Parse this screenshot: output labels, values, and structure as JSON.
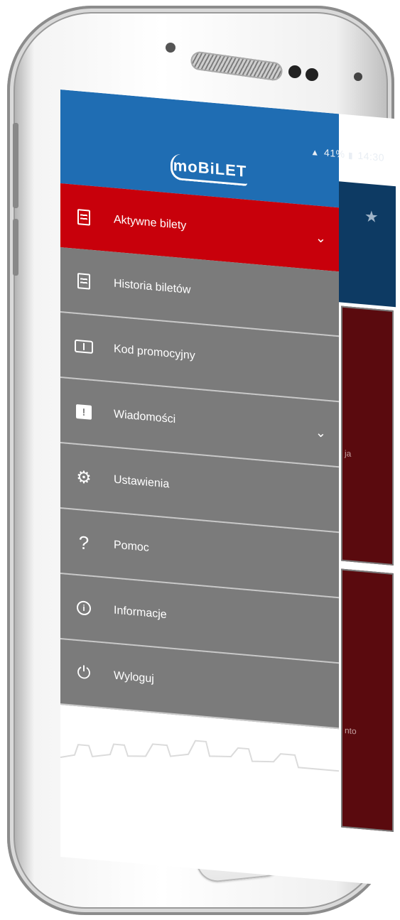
{
  "status_bar": {
    "battery": "41%",
    "time": "14:30"
  },
  "app": {
    "logo": "moBiLET"
  },
  "menu": {
    "items": [
      {
        "label": "Aktywne bilety",
        "icon": "ticket-icon",
        "active": true,
        "has_chevron": true
      },
      {
        "label": "Historia biletów",
        "icon": "ticket-icon",
        "active": false,
        "has_chevron": false
      },
      {
        "label": "Kod promocyjny",
        "icon": "card-icon",
        "active": false,
        "has_chevron": false
      },
      {
        "label": "Wiadomości",
        "icon": "message-icon",
        "active": false,
        "has_chevron": true
      },
      {
        "label": "Ustawienia",
        "icon": "gear-icon",
        "active": false,
        "has_chevron": false
      },
      {
        "label": "Pomoc",
        "icon": "question-icon",
        "active": false,
        "has_chevron": false
      },
      {
        "label": "Informacje",
        "icon": "info-icon",
        "active": false,
        "has_chevron": false
      },
      {
        "label": "Wyloguj",
        "icon": "power-icon",
        "active": false,
        "has_chevron": false
      }
    ]
  },
  "background": {
    "text_1": "ja",
    "text_2": "nto"
  },
  "colors": {
    "header": "#1f6db3",
    "active": "#c8000b",
    "menu": "#7b7b7b",
    "background_header": "#0d3a63"
  }
}
